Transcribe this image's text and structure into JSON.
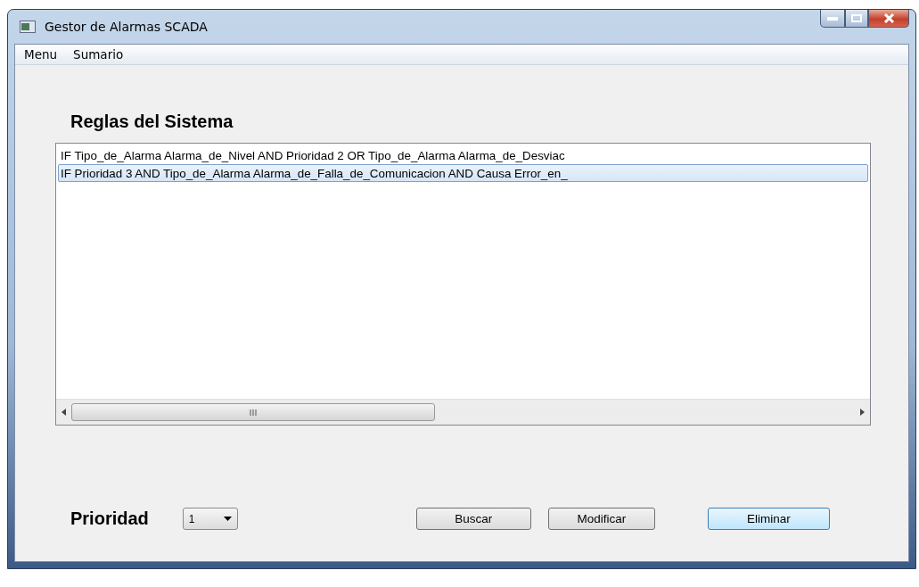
{
  "window": {
    "title": "Gestor de Alarmas SCADA"
  },
  "menu": [
    "Menu",
    "Sumario"
  ],
  "rules_title": "Reglas del Sistema",
  "rules": [
    {
      "text": "IF Tipo_de_Alarma Alarma_de_Nivel AND Prioridad 2 OR Tipo_de_Alarma Alarma_de_Desviac",
      "selected": false
    },
    {
      "text": "IF Prioridad 3 AND Tipo_de_Alarma Alarma_de_Falla_de_Comunicacion AND Causa Error_en_",
      "selected": true
    }
  ],
  "priority": {
    "label": "Prioridad",
    "value": "1"
  },
  "buttons": [
    {
      "label": "Buscar",
      "highlighted": false
    },
    {
      "label": "Modificar",
      "highlighted": false
    },
    {
      "label": "Eliminar",
      "highlighted": true
    }
  ]
}
